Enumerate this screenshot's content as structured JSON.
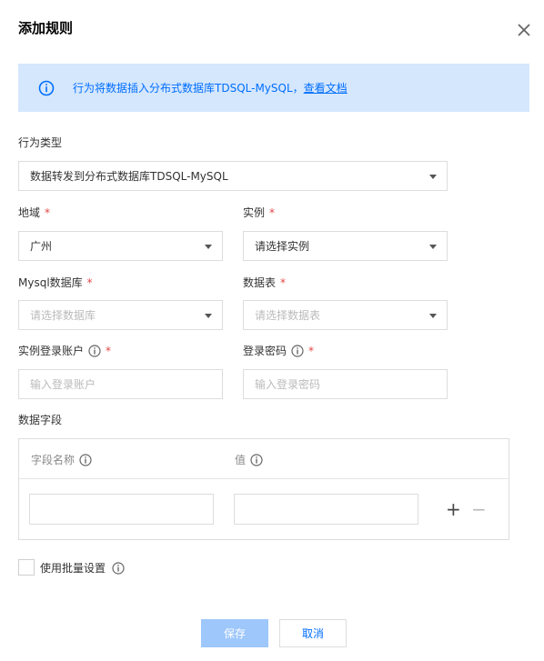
{
  "dialog": {
    "title": "添加规则"
  },
  "banner": {
    "text": "行为将数据插入分布式数据库TDSQL-MySQL，",
    "link": "查看文档"
  },
  "behavior": {
    "label": "行为类型",
    "value": "数据转发到分布式数据库TDSQL-MySQL"
  },
  "region": {
    "label": "地域",
    "required": "*",
    "value": "广州"
  },
  "instance": {
    "label": "实例",
    "required": "*",
    "value": "请选择实例"
  },
  "database": {
    "label": "Mysql数据库",
    "required": "*",
    "placeholder": "请选择数据库"
  },
  "table": {
    "label": "数据表",
    "required": "*",
    "placeholder": "请选择数据表"
  },
  "account": {
    "label": "实例登录账户",
    "required": "*",
    "placeholder": "输入登录账户"
  },
  "password": {
    "label": "登录密码",
    "required": "*",
    "placeholder": "输入登录密码"
  },
  "fields": {
    "label": "数据字段",
    "columns": [
      "字段名称",
      "值"
    ],
    "rows": [
      {
        "name": "",
        "value": ""
      }
    ],
    "add": "+",
    "remove": "−"
  },
  "batch": {
    "label": "使用批量设置"
  },
  "buttons": {
    "save": "保存",
    "cancel": "取消"
  },
  "colors": {
    "accent": "#006eff",
    "banner_bg": "#d5e7fd",
    "required": "#e54545",
    "save_disabled": "#9ec7fb"
  }
}
